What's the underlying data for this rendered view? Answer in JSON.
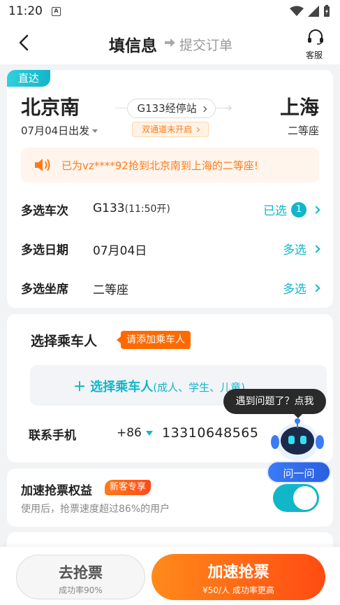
{
  "status_bar": {
    "time": "11:20",
    "sim_label": "A"
  },
  "nav": {
    "title": "填信息",
    "subtitle": "提交订单",
    "service_label": "客服"
  },
  "trip": {
    "tag": "直达",
    "from": "北京南",
    "to": "上海",
    "train_link": "G133经停站",
    "channel_notice": "双通道未开启",
    "date_label": "07月04日出发",
    "seat_class": "二等座",
    "broadcast": "已为vz****92抢到北京南到上海的二等座!"
  },
  "options": {
    "trains": {
      "label": "多选车次",
      "value": "G133",
      "value_extra": "(11:50开)",
      "action": "已选",
      "count": "1"
    },
    "dates": {
      "label": "多选日期",
      "value": "07月04日",
      "action": "多选"
    },
    "seats": {
      "label": "多选坐席",
      "value": "二等座",
      "action": "多选"
    }
  },
  "passengers": {
    "title": "选择乘车人",
    "tag": "请添加乘车人",
    "select_label": "选择乘车人",
    "select_hint": "(成人、学生、儿童)",
    "phone_label": "联系手机",
    "phone_code": "+86",
    "phone_number": "13310648565"
  },
  "speedup": {
    "title": "加速抢票权益",
    "tag": "新客专享",
    "desc": "使用后，抢票速度超过86%的用户",
    "enabled": true
  },
  "assistant": {
    "bubble": "遇到问题了？点我",
    "button": "问一问"
  },
  "bottom": {
    "go_label": "去抢票",
    "go_sub": "成功率90%",
    "speed_label": "加速抢票",
    "speed_sub": "¥50/人 成功率更高"
  },
  "colors": {
    "accent": "#12b6c9",
    "orange": "#ff7a1a",
    "cta_start": "#ff8a1a",
    "cta_end": "#ff4b12"
  }
}
